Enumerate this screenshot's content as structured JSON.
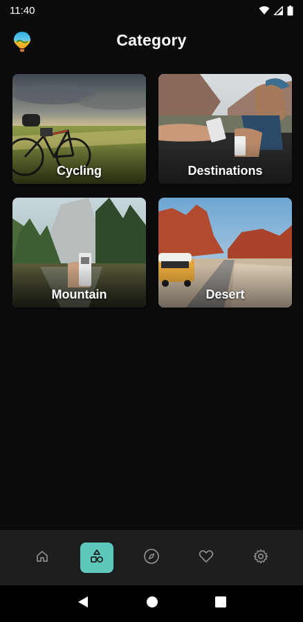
{
  "status_bar": {
    "time": "11:40",
    "icons": [
      "wifi-icon",
      "signal-icon",
      "battery-icon"
    ]
  },
  "header": {
    "title": "Category",
    "logo_icon": "balloon-logo-icon"
  },
  "categories": [
    {
      "label": "Cycling"
    },
    {
      "label": "Destinations"
    },
    {
      "label": "Mountain"
    },
    {
      "label": "Desert"
    }
  ],
  "bottom_nav": {
    "items": [
      {
        "icon": "home-icon",
        "active": false
      },
      {
        "icon": "categories-icon",
        "active": true
      },
      {
        "icon": "compass-icon",
        "active": false
      },
      {
        "icon": "heart-icon",
        "active": false
      },
      {
        "icon": "gear-icon",
        "active": false
      }
    ],
    "active_color": "#5ec8bd"
  },
  "system_nav": {
    "icons": [
      "back-icon",
      "home-circle-icon",
      "recents-icon"
    ]
  }
}
